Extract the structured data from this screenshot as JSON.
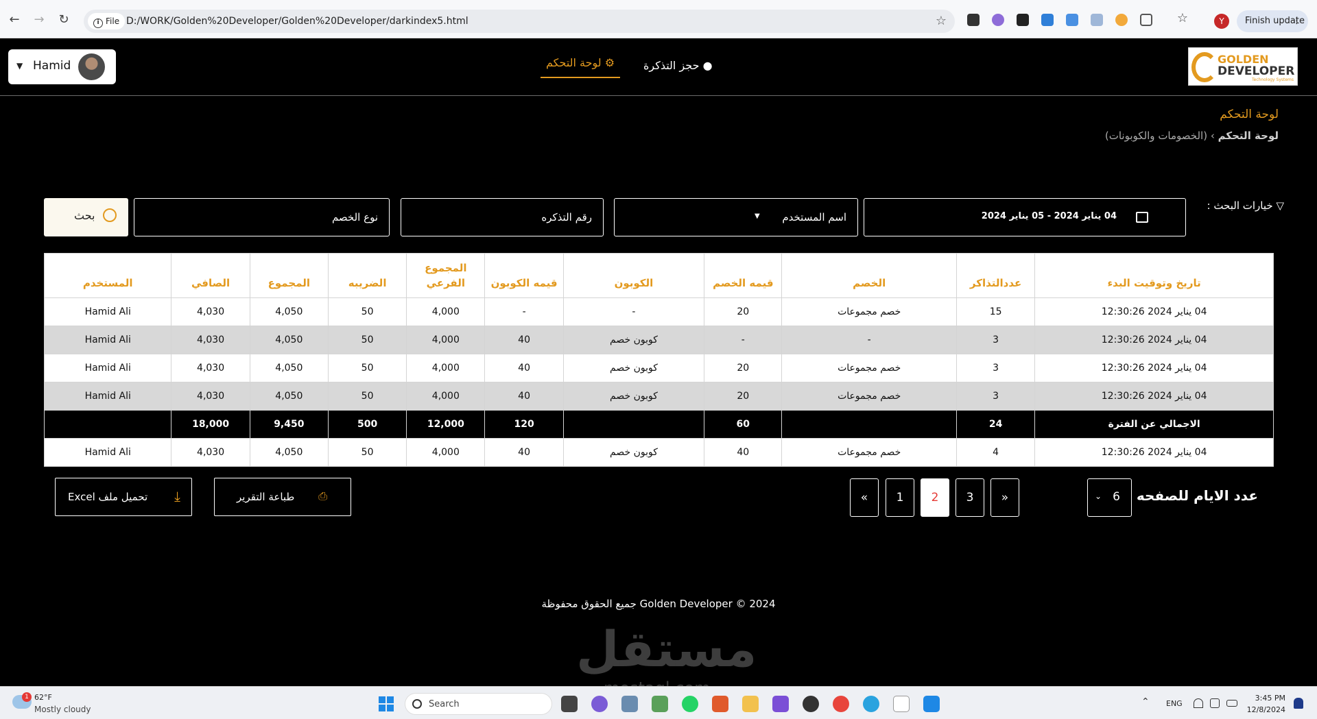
{
  "browser": {
    "file_chip": "File",
    "url": "D:/WORK/Golden%20Developer/Golden%20Developer/darkindex5.html",
    "profile_initial": "Y",
    "finish_update": "Finish update"
  },
  "header": {
    "user_name": "Hamid",
    "nav_dashboard": "لوحة التحكم",
    "nav_booking": "حجز التذكرة",
    "logo_line1": "GOLDEN",
    "logo_line2": "DEVELOPER",
    "logo_line3": "Technology Systems"
  },
  "page": {
    "title": "لوحة التحكم",
    "breadcrumb_root": "لوحة التحكم",
    "breadcrumb_sep": "›",
    "breadcrumb_current": "(الخصومات والكوبونات)"
  },
  "filters": {
    "label": "خيارات البحث :",
    "date_range": "04 يناير 2024 - 05 يناير 2024",
    "user_select": "اسم المستخدم",
    "ticket_no": "رقم التذكره",
    "discount_type": "نوع الخصم",
    "search": "بحث"
  },
  "table": {
    "headers": [
      "تاريخ وتوقيت البدء",
      "عددالتذاكر",
      "الخصم",
      "قيمه الخصم",
      "الكوبون",
      "قيمه الكوبون",
      "المجموع الفرعي",
      "الضريبه",
      "المجموع",
      "الصافي",
      "المستخدم"
    ],
    "rows": [
      {
        "style": "white",
        "cells": [
          "04 يناير 2024 12:30:26",
          "15",
          "خصم مجموعات",
          "20",
          "-",
          "-",
          "4,000",
          "50",
          "4,050",
          "4,030",
          "Hamid Ali"
        ]
      },
      {
        "style": "gray",
        "cells": [
          "04 يناير 2024 12:30:26",
          "3",
          "-",
          "-",
          "كوبون خصم",
          "40",
          "4,000",
          "50",
          "4,050",
          "4,030",
          "Hamid Ali"
        ]
      },
      {
        "style": "white",
        "cells": [
          "04 يناير 2024 12:30:26",
          "3",
          "خصم مجموعات",
          "20",
          "كوبون خصم",
          "40",
          "4,000",
          "50",
          "4,050",
          "4,030",
          "Hamid Ali"
        ]
      },
      {
        "style": "gray",
        "cells": [
          "04 يناير 2024 12:30:26",
          "3",
          "خصم مجموعات",
          "20",
          "كوبون خصم",
          "40",
          "4,000",
          "50",
          "4,050",
          "4,030",
          "Hamid Ali"
        ]
      },
      {
        "style": "total",
        "cells": [
          "الاجمالي عن الفترة",
          "24",
          "",
          "60",
          "",
          "120",
          "12,000",
          "500",
          "9,450",
          "18,000",
          ""
        ]
      },
      {
        "style": "white",
        "cells": [
          "04 يناير 2024 12:30:26",
          "4",
          "خصم مجموعات",
          "40",
          "كوبون خصم",
          "40",
          "4,000",
          "50",
          "4,050",
          "4,030",
          "Hamid Ali"
        ]
      }
    ]
  },
  "controls": {
    "excel": "تحميل ملف Excel",
    "print": "طباعة التقرير",
    "pages": [
      "«",
      "1",
      "2",
      "3",
      "»"
    ],
    "active_page": "2",
    "per_page_label": "عدد الايام للصفحه",
    "per_page_value": "6"
  },
  "footer": "Golden Developer © 2024 جميع الحقوق محفوظة",
  "watermark": {
    "main": "مستقل",
    "sub": "mostaql.com"
  },
  "taskbar": {
    "weather_badge": "1",
    "temp": "62°F",
    "weather": "Mostly cloudy",
    "search": "Search",
    "lang": "ENG",
    "time": "3:45 PM",
    "date": "12/8/2024"
  },
  "colors": {
    "accent": "#e39a1f",
    "background": "#000000",
    "row_gray": "#d8d8d8"
  }
}
